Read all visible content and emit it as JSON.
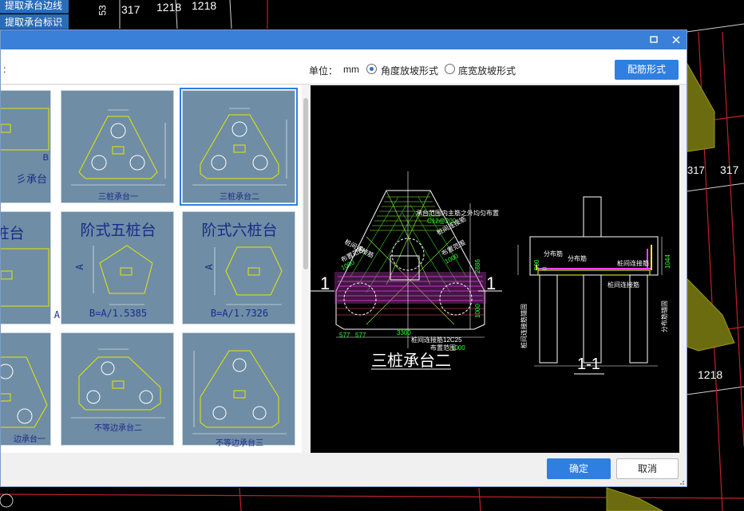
{
  "cad_background": {
    "dims": [
      "317",
      "1218",
      "1218",
      "317",
      "1218",
      "317"
    ],
    "partial_text": "53"
  },
  "side_panel": {
    "buttons": [
      "提取承台边线",
      "提取承台标识"
    ]
  },
  "dialog": {
    "maximize_icon": "square-icon",
    "close_icon": "close-icon",
    "toolbar": {
      "left_text": ":",
      "unit_label": "单位：",
      "unit_value": "mm",
      "option_angle": "角度放坡形式",
      "option_width": "底宽放坡形式",
      "selected_option": "angle",
      "rebar_button": "配筋形式"
    },
    "gallery": {
      "tiles": [
        {
          "title": "",
          "caption": "彡承台",
          "edge_label": "B"
        },
        {
          "title": "",
          "caption": "三桩承台一",
          "selected": false
        },
        {
          "title": "",
          "caption": "三桩承台二",
          "selected": true
        },
        {
          "title": "可桩台",
          "caption": "A",
          "edge_label": ""
        },
        {
          "title": "阶式五桩台",
          "caption": "B=A/1.5385",
          "side_label": "A"
        },
        {
          "title": "阶式六桩台",
          "caption": "B=A/1.7326",
          "side_label": "A"
        },
        {
          "title": "",
          "caption": "边承台一"
        },
        {
          "title": "",
          "caption": "不等边承台二"
        },
        {
          "title": "",
          "caption": "不等边承台三"
        }
      ]
    },
    "preview": {
      "caption_main": "三桩承台二",
      "caption_section": "1-1",
      "section_marks": [
        "1",
        "1"
      ],
      "annotations": [
        "承台范围内主筋之外均匀布置",
        "C12@200",
        "桩间连接筋",
        "布置范围",
        "1000",
        "桩间连接筋",
        "布置范围",
        "1000",
        "2886",
        "1000",
        "577",
        "577",
        "3300",
        "桩间连接筋12C25",
        "布置范围",
        "1000",
        "分布筋",
        "分布筋",
        "桩间连接筋",
        "桩间连接筋",
        "500",
        "0",
        "1044",
        "桩间连接筋锚固",
        "分布筋锚固"
      ]
    },
    "footer": {
      "ok": "确定",
      "cancel": "取消"
    }
  },
  "colors": {
    "title_bar": "#3a7fd8",
    "accent_button": "#2f7fe0",
    "tile_bg": "#6f8da5",
    "cad_bg": "#000000"
  }
}
